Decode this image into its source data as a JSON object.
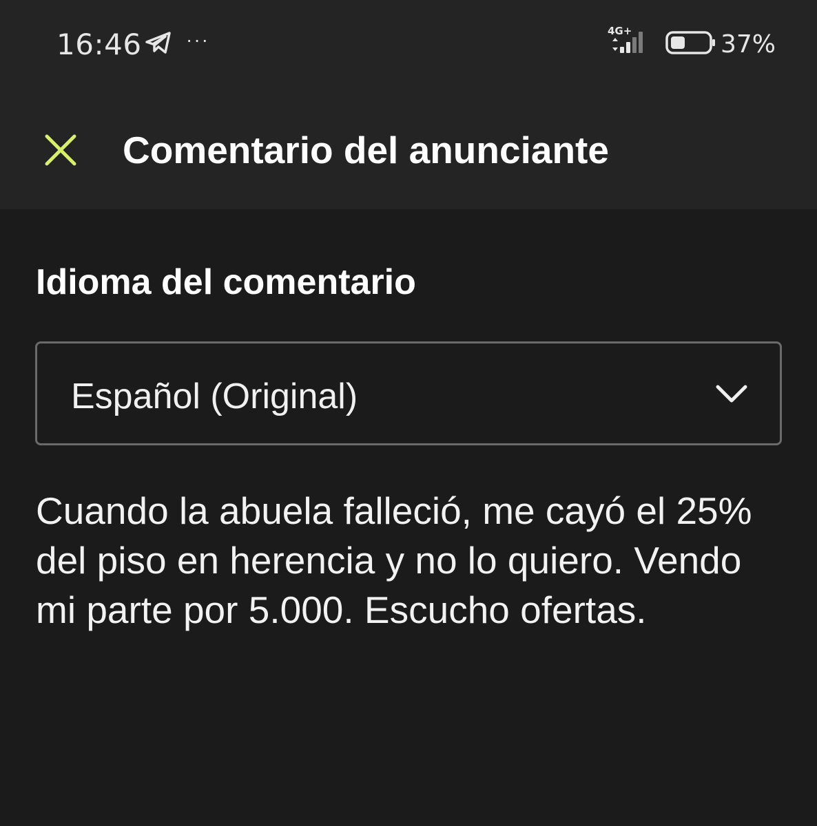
{
  "status_bar": {
    "time": "16:46",
    "more": "···",
    "network": "4G+",
    "battery": "37%",
    "icons": [
      "telegram-icon",
      "more-icon",
      "network-icon",
      "battery-icon"
    ]
  },
  "header": {
    "close_icon": "close-icon",
    "title": "Comentario del anunciante",
    "accent_color": "#d7f06b"
  },
  "main": {
    "section_title": "Idioma del comentario",
    "language_select": {
      "value": "Español (Original)",
      "icon": "chevron-down-icon"
    },
    "comment": "Cuando la abuela falleció, me cayó el 25% del piso en herencia y no lo quiero. Vendo mi parte por 5.000. Escucho ofertas."
  }
}
